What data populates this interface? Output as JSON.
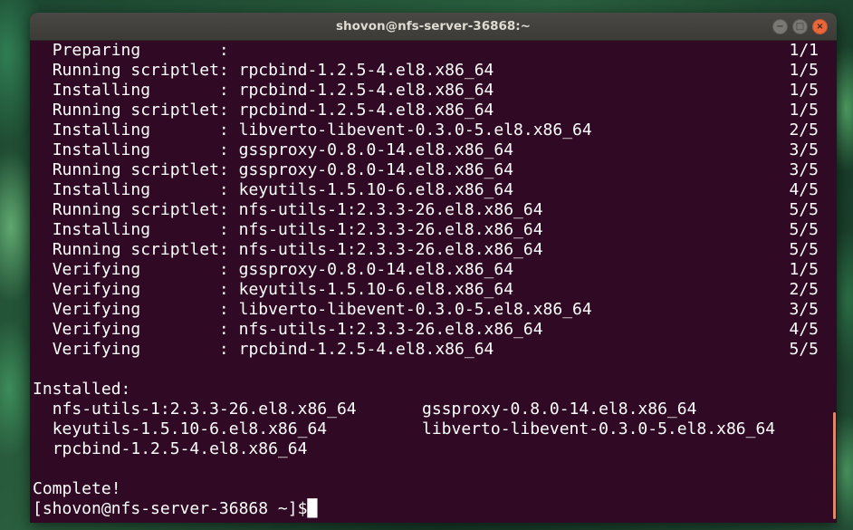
{
  "window": {
    "title": "shovon@nfs-server-36868:~",
    "controls": {
      "minimize": "−",
      "maximize": "□",
      "close": "×"
    }
  },
  "terminal": {
    "transactions": [
      {
        "action": "Preparing        :",
        "package": "",
        "progress": "1/1"
      },
      {
        "action": "Running scriptlet:",
        "package": " rpcbind-1.2.5-4.el8.x86_64",
        "progress": "1/5"
      },
      {
        "action": "Installing       :",
        "package": " rpcbind-1.2.5-4.el8.x86_64",
        "progress": "1/5"
      },
      {
        "action": "Running scriptlet:",
        "package": " rpcbind-1.2.5-4.el8.x86_64",
        "progress": "1/5"
      },
      {
        "action": "Installing       :",
        "package": " libverto-libevent-0.3.0-5.el8.x86_64",
        "progress": "2/5"
      },
      {
        "action": "Installing       :",
        "package": " gssproxy-0.8.0-14.el8.x86_64",
        "progress": "3/5"
      },
      {
        "action": "Running scriptlet:",
        "package": " gssproxy-0.8.0-14.el8.x86_64",
        "progress": "3/5"
      },
      {
        "action": "Installing       :",
        "package": " keyutils-1.5.10-6.el8.x86_64",
        "progress": "4/5"
      },
      {
        "action": "Running scriptlet:",
        "package": " nfs-utils-1:2.3.3-26.el8.x86_64",
        "progress": "5/5"
      },
      {
        "action": "Installing       :",
        "package": " nfs-utils-1:2.3.3-26.el8.x86_64",
        "progress": "5/5"
      },
      {
        "action": "Running scriptlet:",
        "package": " nfs-utils-1:2.3.3-26.el8.x86_64",
        "progress": "5/5"
      },
      {
        "action": "Verifying        :",
        "package": " gssproxy-0.8.0-14.el8.x86_64",
        "progress": "1/5"
      },
      {
        "action": "Verifying        :",
        "package": " keyutils-1.5.10-6.el8.x86_64",
        "progress": "2/5"
      },
      {
        "action": "Verifying        :",
        "package": " libverto-libevent-0.3.0-5.el8.x86_64",
        "progress": "3/5"
      },
      {
        "action": "Verifying        :",
        "package": " nfs-utils-1:2.3.3-26.el8.x86_64",
        "progress": "4/5"
      },
      {
        "action": "Verifying        :",
        "package": " rpcbind-1.2.5-4.el8.x86_64",
        "progress": "5/5"
      }
    ],
    "installed_header": "Installed:",
    "installed": [
      [
        "nfs-utils-1:2.3.3-26.el8.x86_64",
        "gssproxy-0.8.0-14.el8.x86_64"
      ],
      [
        "keyutils-1.5.10-6.el8.x86_64",
        "libverto-libevent-0.3.0-5.el8.x86_64"
      ],
      [
        "rpcbind-1.2.5-4.el8.x86_64",
        ""
      ]
    ],
    "complete": "Complete!",
    "prompt": "[shovon@nfs-server-36868 ~]$",
    "cursor": "█"
  }
}
